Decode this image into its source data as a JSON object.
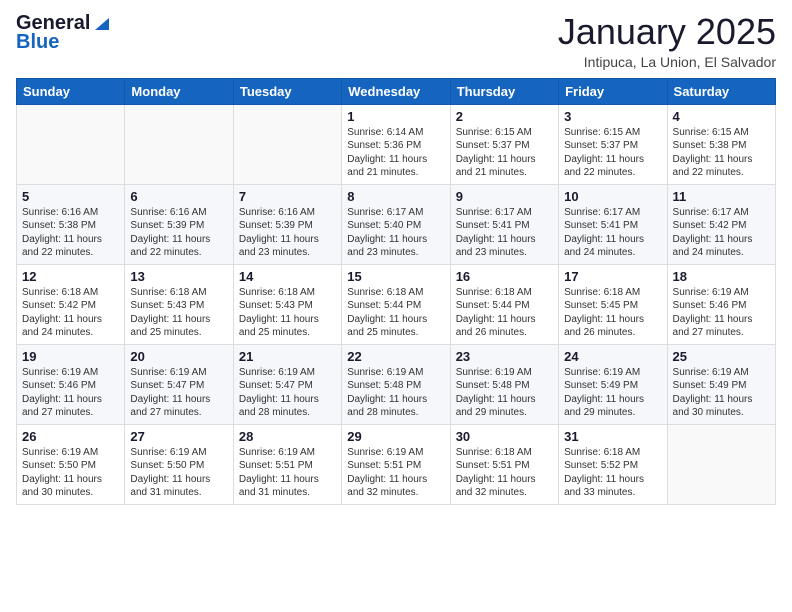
{
  "logo": {
    "general": "General",
    "blue": "Blue"
  },
  "header": {
    "month": "January 2025",
    "location": "Intipuca, La Union, El Salvador"
  },
  "weekdays": [
    "Sunday",
    "Monday",
    "Tuesday",
    "Wednesday",
    "Thursday",
    "Friday",
    "Saturday"
  ],
  "weeks": [
    [
      {
        "day": "",
        "sunrise": "",
        "sunset": "",
        "daylight": ""
      },
      {
        "day": "",
        "sunrise": "",
        "sunset": "",
        "daylight": ""
      },
      {
        "day": "",
        "sunrise": "",
        "sunset": "",
        "daylight": ""
      },
      {
        "day": "1",
        "sunrise": "Sunrise: 6:14 AM",
        "sunset": "Sunset: 5:36 PM",
        "daylight": "Daylight: 11 hours and 21 minutes."
      },
      {
        "day": "2",
        "sunrise": "Sunrise: 6:15 AM",
        "sunset": "Sunset: 5:37 PM",
        "daylight": "Daylight: 11 hours and 21 minutes."
      },
      {
        "day": "3",
        "sunrise": "Sunrise: 6:15 AM",
        "sunset": "Sunset: 5:37 PM",
        "daylight": "Daylight: 11 hours and 22 minutes."
      },
      {
        "day": "4",
        "sunrise": "Sunrise: 6:15 AM",
        "sunset": "Sunset: 5:38 PM",
        "daylight": "Daylight: 11 hours and 22 minutes."
      }
    ],
    [
      {
        "day": "5",
        "sunrise": "Sunrise: 6:16 AM",
        "sunset": "Sunset: 5:38 PM",
        "daylight": "Daylight: 11 hours and 22 minutes."
      },
      {
        "day": "6",
        "sunrise": "Sunrise: 6:16 AM",
        "sunset": "Sunset: 5:39 PM",
        "daylight": "Daylight: 11 hours and 22 minutes."
      },
      {
        "day": "7",
        "sunrise": "Sunrise: 6:16 AM",
        "sunset": "Sunset: 5:39 PM",
        "daylight": "Daylight: 11 hours and 23 minutes."
      },
      {
        "day": "8",
        "sunrise": "Sunrise: 6:17 AM",
        "sunset": "Sunset: 5:40 PM",
        "daylight": "Daylight: 11 hours and 23 minutes."
      },
      {
        "day": "9",
        "sunrise": "Sunrise: 6:17 AM",
        "sunset": "Sunset: 5:41 PM",
        "daylight": "Daylight: 11 hours and 23 minutes."
      },
      {
        "day": "10",
        "sunrise": "Sunrise: 6:17 AM",
        "sunset": "Sunset: 5:41 PM",
        "daylight": "Daylight: 11 hours and 24 minutes."
      },
      {
        "day": "11",
        "sunrise": "Sunrise: 6:17 AM",
        "sunset": "Sunset: 5:42 PM",
        "daylight": "Daylight: 11 hours and 24 minutes."
      }
    ],
    [
      {
        "day": "12",
        "sunrise": "Sunrise: 6:18 AM",
        "sunset": "Sunset: 5:42 PM",
        "daylight": "Daylight: 11 hours and 24 minutes."
      },
      {
        "day": "13",
        "sunrise": "Sunrise: 6:18 AM",
        "sunset": "Sunset: 5:43 PM",
        "daylight": "Daylight: 11 hours and 25 minutes."
      },
      {
        "day": "14",
        "sunrise": "Sunrise: 6:18 AM",
        "sunset": "Sunset: 5:43 PM",
        "daylight": "Daylight: 11 hours and 25 minutes."
      },
      {
        "day": "15",
        "sunrise": "Sunrise: 6:18 AM",
        "sunset": "Sunset: 5:44 PM",
        "daylight": "Daylight: 11 hours and 25 minutes."
      },
      {
        "day": "16",
        "sunrise": "Sunrise: 6:18 AM",
        "sunset": "Sunset: 5:44 PM",
        "daylight": "Daylight: 11 hours and 26 minutes."
      },
      {
        "day": "17",
        "sunrise": "Sunrise: 6:18 AM",
        "sunset": "Sunset: 5:45 PM",
        "daylight": "Daylight: 11 hours and 26 minutes."
      },
      {
        "day": "18",
        "sunrise": "Sunrise: 6:19 AM",
        "sunset": "Sunset: 5:46 PM",
        "daylight": "Daylight: 11 hours and 27 minutes."
      }
    ],
    [
      {
        "day": "19",
        "sunrise": "Sunrise: 6:19 AM",
        "sunset": "Sunset: 5:46 PM",
        "daylight": "Daylight: 11 hours and 27 minutes."
      },
      {
        "day": "20",
        "sunrise": "Sunrise: 6:19 AM",
        "sunset": "Sunset: 5:47 PM",
        "daylight": "Daylight: 11 hours and 27 minutes."
      },
      {
        "day": "21",
        "sunrise": "Sunrise: 6:19 AM",
        "sunset": "Sunset: 5:47 PM",
        "daylight": "Daylight: 11 hours and 28 minutes."
      },
      {
        "day": "22",
        "sunrise": "Sunrise: 6:19 AM",
        "sunset": "Sunset: 5:48 PM",
        "daylight": "Daylight: 11 hours and 28 minutes."
      },
      {
        "day": "23",
        "sunrise": "Sunrise: 6:19 AM",
        "sunset": "Sunset: 5:48 PM",
        "daylight": "Daylight: 11 hours and 29 minutes."
      },
      {
        "day": "24",
        "sunrise": "Sunrise: 6:19 AM",
        "sunset": "Sunset: 5:49 PM",
        "daylight": "Daylight: 11 hours and 29 minutes."
      },
      {
        "day": "25",
        "sunrise": "Sunrise: 6:19 AM",
        "sunset": "Sunset: 5:49 PM",
        "daylight": "Daylight: 11 hours and 30 minutes."
      }
    ],
    [
      {
        "day": "26",
        "sunrise": "Sunrise: 6:19 AM",
        "sunset": "Sunset: 5:50 PM",
        "daylight": "Daylight: 11 hours and 30 minutes."
      },
      {
        "day": "27",
        "sunrise": "Sunrise: 6:19 AM",
        "sunset": "Sunset: 5:50 PM",
        "daylight": "Daylight: 11 hours and 31 minutes."
      },
      {
        "day": "28",
        "sunrise": "Sunrise: 6:19 AM",
        "sunset": "Sunset: 5:51 PM",
        "daylight": "Daylight: 11 hours and 31 minutes."
      },
      {
        "day": "29",
        "sunrise": "Sunrise: 6:19 AM",
        "sunset": "Sunset: 5:51 PM",
        "daylight": "Daylight: 11 hours and 32 minutes."
      },
      {
        "day": "30",
        "sunrise": "Sunrise: 6:18 AM",
        "sunset": "Sunset: 5:51 PM",
        "daylight": "Daylight: 11 hours and 32 minutes."
      },
      {
        "day": "31",
        "sunrise": "Sunrise: 6:18 AM",
        "sunset": "Sunset: 5:52 PM",
        "daylight": "Daylight: 11 hours and 33 minutes."
      },
      {
        "day": "",
        "sunrise": "",
        "sunset": "",
        "daylight": ""
      }
    ]
  ]
}
